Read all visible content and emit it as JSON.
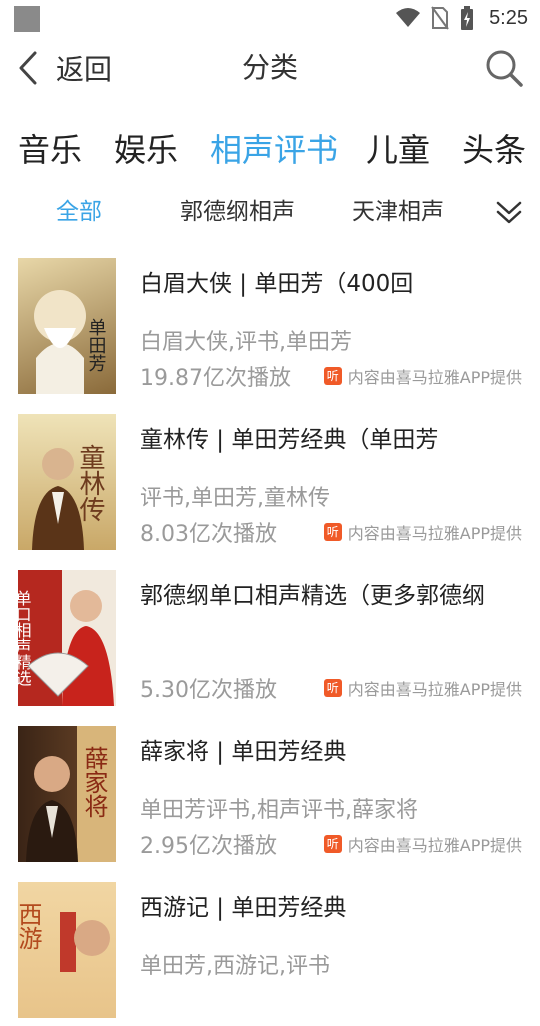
{
  "status_bar": {
    "time": "5:25"
  },
  "header": {
    "back_label": "返回",
    "title": "分类"
  },
  "tabs": [
    {
      "label": "音乐",
      "active": false
    },
    {
      "label": "娱乐",
      "active": false
    },
    {
      "label": "相声评书",
      "active": true
    },
    {
      "label": "儿童",
      "active": false
    },
    {
      "label": "头条",
      "active": false
    }
  ],
  "subtabs": [
    {
      "label": "全部",
      "active": true
    },
    {
      "label": "郭德纲相声",
      "active": false
    },
    {
      "label": "天津相声",
      "active": false
    }
  ],
  "items": [
    {
      "title": "白眉大侠 | 单田芳（400回",
      "tags": "白眉大侠,评书,单田芳",
      "plays": "19.87亿次播放",
      "source": "内容由喜马拉雅APP提供",
      "cover_text": "单田芳",
      "cover_colors": [
        "#e8d7a8",
        "#8a6a3a"
      ]
    },
    {
      "title": "童林传 | 单田芳经典（单田芳",
      "tags": "评书,单田芳,童林传",
      "plays": "8.03亿次播放",
      "source": "内容由喜马拉雅APP提供",
      "cover_text": "童林传",
      "cover_colors": [
        "#efe3b8",
        "#6e3b1e"
      ]
    },
    {
      "title": "郭德纲单口相声精选（更多郭德纲",
      "tags": "",
      "plays": "5.30亿次播放",
      "source": "内容由喜马拉雅APP提供",
      "cover_text": "单口相声精选",
      "cover_colors": [
        "#b5281f",
        "#f1e9dd"
      ]
    },
    {
      "title": "薛家将 | 单田芳经典",
      "tags": "单田芳评书,相声评书,薛家将",
      "plays": "2.95亿次播放",
      "source": "内容由喜马拉雅APP提供",
      "cover_text": "薛家将",
      "cover_colors": [
        "#3a2416",
        "#d8b57a"
      ]
    },
    {
      "title": "西游记 | 单田芳经典",
      "tags": "单田芳,西游记,评书",
      "plays": "",
      "source": "",
      "cover_text": "西游",
      "cover_colors": [
        "#f1d6a3",
        "#b34a1e"
      ]
    }
  ],
  "colors": {
    "accent": "#3aa4e6",
    "source_badge": "#f05a28"
  }
}
